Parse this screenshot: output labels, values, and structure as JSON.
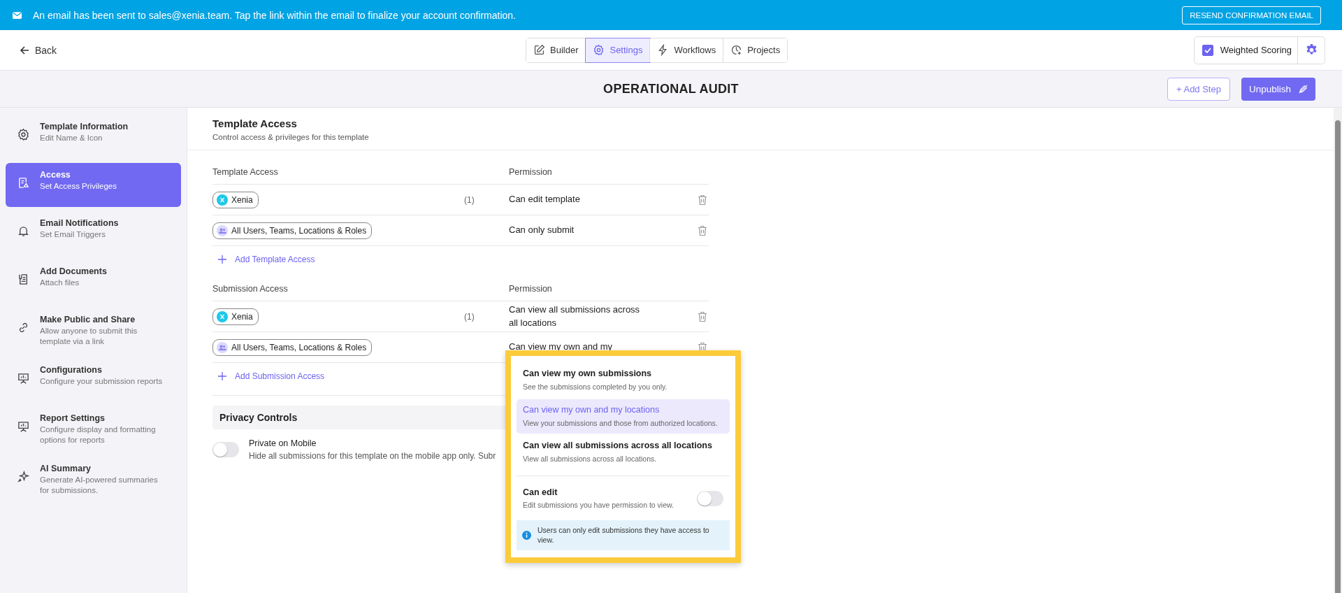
{
  "banner": {
    "message": "An email has been sent to sales@xenia.team. Tap the link within the email to finalize your account confirmation.",
    "button": "RESEND CONFIRMATION EMAIL"
  },
  "header": {
    "back": "Back",
    "tabs": [
      {
        "label": "Builder",
        "selected": false,
        "kind": "pencil"
      },
      {
        "label": "Settings",
        "selected": true,
        "kind": "gear"
      },
      {
        "label": "Workflows",
        "selected": false,
        "kind": "bolt"
      },
      {
        "label": "Projects",
        "selected": false,
        "kind": "clock"
      }
    ],
    "weighted_scoring": {
      "label": "Weighted Scoring",
      "checked": true
    }
  },
  "title": "OPERATIONAL AUDIT",
  "add_step": "+ Add Step",
  "unpublish": "Unpublish",
  "sidebar": {
    "items": [
      {
        "title": "Template Information",
        "subtitle": "Edit Name & Icon",
        "selected": false
      },
      {
        "title": "Access",
        "subtitle": "Set Access Privileges",
        "selected": true
      },
      {
        "title": "Email Notifications",
        "subtitle": "Set Email Triggers",
        "selected": false
      },
      {
        "title": "Add Documents",
        "subtitle": "Attach files",
        "selected": false
      },
      {
        "title": "Make Public and Share",
        "subtitle": "Allow anyone to submit this template via a link",
        "selected": false
      },
      {
        "title": "Configurations",
        "subtitle": "Configure your submission reports",
        "selected": false
      },
      {
        "title": "Report Settings",
        "subtitle": "Configure display and formatting options for reports",
        "selected": false
      },
      {
        "title": "AI Summary",
        "subtitle": "Generate AI-powered summaries for submissions.",
        "selected": false
      }
    ]
  },
  "section": {
    "title": "Template Access",
    "subtitle": "Control access & privileges for this template"
  },
  "tables": [
    {
      "column_1": "Template Access",
      "column_2": "Permission",
      "rows": [
        {
          "chip": "Xenia",
          "kind": "user",
          "count": "(1)",
          "permission": "Can edit template"
        },
        {
          "chip": "All Users, Teams, Locations & Roles",
          "kind": "group",
          "permission": "Can only submit"
        }
      ],
      "add": "Add Template Access"
    },
    {
      "column_1": "Submission Access",
      "column_2": "Permission",
      "rows": [
        {
          "chip": "Xenia",
          "kind": "user",
          "count": "(1)",
          "permission": "Can view all submissions across all locations"
        },
        {
          "chip": "All Users, Teams, Locations & Roles",
          "kind": "group",
          "permission": "Can view my own and my"
        }
      ],
      "add": "Add Submission Access"
    }
  ],
  "privacy": {
    "title": "Privacy Controls",
    "label": "Private on Mobile",
    "description": "Hide all submissions for this template on the mobile app only. Subr",
    "on": false
  },
  "dropdown": {
    "options": [
      {
        "title": "Can view my own submissions",
        "description": "See the submissions completed by you only.",
        "selected": false
      },
      {
        "title": "Can view my own and my locations",
        "description": "View your submissions and those from authorized locations.",
        "selected": true
      },
      {
        "title": "Can view all submissions across all locations",
        "description": "View all submissions across all locations.",
        "selected": false
      }
    ],
    "can_edit": {
      "title": "Can edit",
      "description": "Edit submissions you have permission to view.",
      "on": false
    },
    "info": "Users can only edit submissions they have access to view."
  }
}
